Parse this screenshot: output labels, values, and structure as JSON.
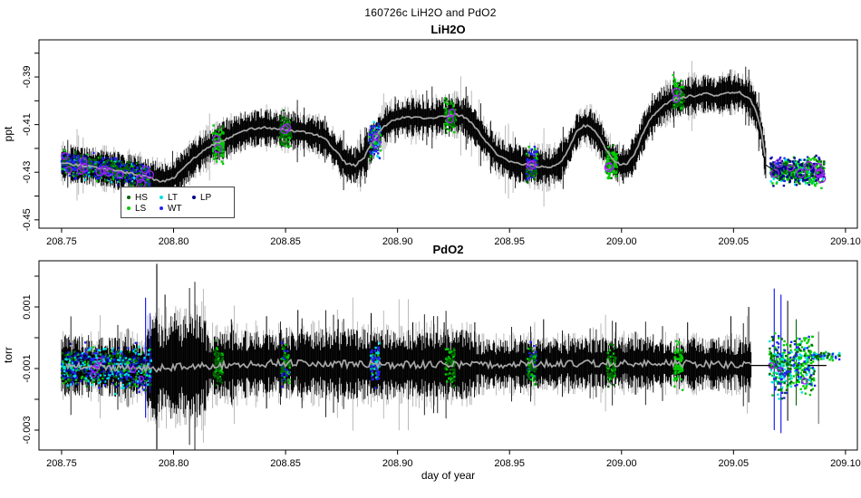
{
  "title": "160726c  LiH2O and PdO2",
  "colors": {
    "HS": "#006400",
    "LS": "#00CD00",
    "LT": "#00E0E0",
    "WT": "#2222EE",
    "LP": "#00008B",
    "circle": "#A020F0",
    "mean_line": "#A6A6A6",
    "noise": "#000000",
    "noise_fringe": "#7E7E7E",
    "axis": "#000000"
  },
  "chart_data": [
    {
      "type": "line",
      "title": "LiH2O",
      "ylabel": "ppt",
      "xlabel": "",
      "xlim": [
        208.7399,
        209.1053
      ],
      "ylim": [
        -0.4535,
        -0.3744
      ],
      "grid": false,
      "legend_position": "bottom-left-inside",
      "legend": {
        "rows": [
          [
            "HS",
            "LT",
            "LP"
          ],
          [
            "LS",
            "WT"
          ]
        ]
      },
      "xticks": {
        "values": [
          208.75,
          208.8,
          208.85,
          208.9,
          208.95,
          209.0,
          209.05,
          209.1
        ],
        "labels": [
          "208.75",
          "208.80",
          "208.85",
          "208.90",
          "208.95",
          "209.00",
          "209.05",
          "209.10"
        ]
      },
      "yticks": {
        "values": [
          -0.39,
          -0.41,
          -0.43,
          -0.45
        ],
        "labels": [
          "-0.39",
          "-0.41",
          "-0.43",
          "-0.45"
        ],
        "minor": [
          -0.38,
          -0.4,
          -0.42,
          -0.44
        ]
      },
      "noise": {
        "x_range": [
          208.75,
          209.0645
        ],
        "base_amp": 0.006,
        "segments": [
          [
            208.7,
            209.11,
            0.006
          ]
        ]
      },
      "mean": {
        "x_range": [
          208.75,
          209.0645
        ],
        "jitter": 0.0005,
        "points": [
          [
            208.75,
            -0.4262
          ],
          [
            208.758,
            -0.427
          ],
          [
            208.766,
            -0.428
          ],
          [
            208.774,
            -0.4292
          ],
          [
            208.782,
            -0.4306
          ],
          [
            208.79,
            -0.4326
          ],
          [
            208.795,
            -0.434
          ],
          [
            208.799,
            -0.433
          ],
          [
            208.804,
            -0.429
          ],
          [
            208.809,
            -0.4242
          ],
          [
            208.814,
            -0.4205
          ],
          [
            208.819,
            -0.4178
          ],
          [
            208.823,
            -0.4162
          ],
          [
            208.828,
            -0.414
          ],
          [
            208.833,
            -0.4122
          ],
          [
            208.839,
            -0.4113
          ],
          [
            208.845,
            -0.4116
          ],
          [
            208.851,
            -0.4123
          ],
          [
            208.857,
            -0.4129
          ],
          [
            208.863,
            -0.414
          ],
          [
            208.868,
            -0.4163
          ],
          [
            208.873,
            -0.4218
          ],
          [
            208.877,
            -0.4262
          ],
          [
            208.881,
            -0.4272
          ],
          [
            208.885,
            -0.4238
          ],
          [
            208.889,
            -0.417
          ],
          [
            208.893,
            -0.4115
          ],
          [
            208.897,
            -0.4085
          ],
          [
            208.902,
            -0.4072
          ],
          [
            208.908,
            -0.4068
          ],
          [
            208.914,
            -0.4072
          ],
          [
            208.92,
            -0.4064
          ],
          [
            208.926,
            -0.4058
          ],
          [
            208.93,
            -0.4068
          ],
          [
            208.934,
            -0.4105
          ],
          [
            208.939,
            -0.4165
          ],
          [
            208.944,
            -0.4222
          ],
          [
            208.949,
            -0.4252
          ],
          [
            208.955,
            -0.4266
          ],
          [
            208.961,
            -0.4274
          ],
          [
            208.967,
            -0.4282
          ],
          [
            208.972,
            -0.4266
          ],
          [
            208.976,
            -0.4212
          ],
          [
            208.98,
            -0.413
          ],
          [
            208.983,
            -0.4105
          ],
          [
            208.986,
            -0.4107
          ],
          [
            208.99,
            -0.415
          ],
          [
            208.994,
            -0.422
          ],
          [
            208.997,
            -0.4258
          ],
          [
            209.0,
            -0.4268
          ],
          [
            209.003,
            -0.4262
          ],
          [
            209.006,
            -0.422
          ],
          [
            209.009,
            -0.415
          ],
          [
            209.012,
            -0.409
          ],
          [
            209.016,
            -0.404
          ],
          [
            209.02,
            -0.401
          ],
          [
            209.024,
            -0.3992
          ],
          [
            209.028,
            -0.3984
          ],
          [
            209.033,
            -0.3978
          ],
          [
            209.038,
            -0.397
          ],
          [
            209.043,
            -0.3978
          ],
          [
            209.048,
            -0.3964
          ],
          [
            209.053,
            -0.3966
          ],
          [
            209.057,
            -0.3988
          ],
          [
            209.06,
            -0.404
          ],
          [
            209.0625,
            -0.4135
          ],
          [
            209.0645,
            -0.427
          ]
        ]
      },
      "spikes": [],
      "clusters": {
        "spread_discrete": 0.0095,
        "width_discrete": 0.005,
        "discrete_circles": 2,
        "dense": [
          {
            "x_range": [
              208.75,
              208.7895
            ],
            "level": "follow",
            "spread": 0.0072,
            "palette": [
              "WT",
              "LP",
              "WT",
              "LP",
              "LS",
              "HS",
              "LT",
              "LS",
              "HS",
              "WT"
            ],
            "n": 780,
            "circles": 13,
            "circle_r": 3.4
          },
          {
            "x_range": [
              209.0665,
              209.0905
            ],
            "level": -0.4295,
            "spread": 0.0075,
            "palette": [
              "LS",
              "HS",
              "WT",
              "LT",
              "LP",
              "LS"
            ],
            "n": 620,
            "circles": 9,
            "circle_r": 3.4
          }
        ],
        "discrete": [
          {
            "day": 208.82,
            "level": -0.418,
            "palette": [
              "LS",
              "HS",
              "LS"
            ],
            "n": 125
          },
          {
            "day": 208.85,
            "level": -0.4128,
            "palette": [
              "LS",
              "HS"
            ],
            "n": 120
          },
          {
            "day": 208.89,
            "level": -0.4165,
            "palette": [
              "LS",
              "LT",
              "WT",
              "HS",
              "WT"
            ],
            "n": 135
          },
          {
            "day": 208.9235,
            "level": -0.4068,
            "palette": [
              "LS",
              "HS",
              "LS"
            ],
            "n": 120
          },
          {
            "day": 208.96,
            "level": -0.4275,
            "palette": [
              "LS",
              "HS",
              "WT",
              "WT"
            ],
            "n": 125
          },
          {
            "day": 208.9955,
            "level": -0.4262,
            "palette": [
              "LS",
              "LS",
              "HS"
            ],
            "n": 115
          },
          {
            "day": 209.0255,
            "level": -0.3982,
            "palette": [
              "LS",
              "HS",
              "LS"
            ],
            "n": 120
          }
        ]
      },
      "extra_lines": [
        {
          "pts": [
            [
              209.0645,
              -0.427
            ],
            [
              209.0685,
              -0.4295
            ]
          ],
          "width": 1
        }
      ]
    },
    {
      "type": "line",
      "title": "PdO2",
      "ylabel": "torr",
      "xlabel": "day of year",
      "xlim": [
        208.7399,
        209.1053
      ],
      "ylim": [
        -0.003647,
        0.0025
      ],
      "grid": false,
      "xticks": {
        "values": [
          208.75,
          208.8,
          208.85,
          208.9,
          208.95,
          209.0,
          209.05,
          209.1
        ],
        "labels": [
          "208.75",
          "208.80",
          "208.85",
          "208.90",
          "208.95",
          "209.00",
          "209.05",
          "209.10"
        ]
      },
      "yticks": {
        "values": [
          0.001,
          -0.001,
          -0.003
        ],
        "labels": [
          "0.001",
          "-0.001",
          "-0.003"
        ],
        "minor": [
          0.002,
          0.0,
          -0.002
        ]
      },
      "noise": {
        "x_range": [
          208.75,
          209.058
        ],
        "base_amp": 0.0007,
        "segments": [
          [
            208.7,
            208.788,
            0.00075
          ],
          [
            208.788,
            208.814,
            0.00125
          ],
          [
            208.814,
            208.935,
            0.00085
          ],
          [
            208.935,
            209.11,
            0.00062
          ]
        ]
      },
      "mean": {
        "x_range": [
          208.752,
          209.058
        ],
        "jitter": 0.00012,
        "points": [
          [
            208.752,
            -0.0009
          ],
          [
            208.79,
            -0.001
          ],
          [
            208.81,
            -0.00092
          ],
          [
            208.85,
            -0.00082
          ],
          [
            208.9,
            -0.00088
          ],
          [
            208.95,
            -0.00086
          ],
          [
            209.0,
            -0.00082
          ],
          [
            209.04,
            -0.00086
          ],
          [
            209.058,
            -0.00088
          ]
        ]
      },
      "spikes": [
        {
          "d": 208.7875,
          "hi": 0.0013,
          "lo": -0.0026,
          "color": "WT",
          "w": 1.2
        },
        {
          "d": 208.7895,
          "hi": 0.0008,
          "lo": -0.0018,
          "color": "WT",
          "w": 1
        },
        {
          "d": 208.7925,
          "hi": 0.0024,
          "lo": -0.00362,
          "color": "noise",
          "w": 1.1
        },
        {
          "d": 208.7962,
          "hi": 0.0014,
          "lo": -0.0016,
          "color": "noise",
          "w": 1
        },
        {
          "d": 208.8005,
          "hi": 0.0008,
          "lo": -0.0023,
          "color": "noise",
          "w": 1
        },
        {
          "d": 208.8118,
          "hi": 0.0007,
          "lo": -0.0025,
          "color": "noise",
          "w": 1
        },
        {
          "d": 208.8258,
          "hi": 0.0006,
          "lo": -0.0021,
          "color": "noise",
          "w": 1
        },
        {
          "d": 208.8415,
          "hi": 0.0007,
          "lo": -0.0023,
          "color": "noise",
          "w": 1
        },
        {
          "d": 208.8555,
          "hi": 0.0009,
          "lo": -0.0019,
          "color": "noise",
          "w": 1
        },
        {
          "d": 208.8735,
          "hi": 0.0006,
          "lo": -0.0021,
          "color": "noise",
          "w": 1
        },
        {
          "d": 208.8882,
          "hi": 0.0008,
          "lo": -0.0017,
          "color": "noise",
          "w": 1
        },
        {
          "d": 208.9068,
          "hi": 0.0005,
          "lo": -0.0019,
          "color": "noise",
          "w": 1
        },
        {
          "d": 208.9208,
          "hi": 0.0005,
          "lo": -0.0015,
          "color": "noise",
          "w": 1
        },
        {
          "d": 208.9345,
          "hi": 0.0005,
          "lo": -0.0017,
          "color": "noise",
          "w": 1
        },
        {
          "d": 208.9652,
          "hi": 0.0006,
          "lo": -0.0015,
          "color": "noise",
          "w": 1
        },
        {
          "d": 208.9975,
          "hi": 0.0005,
          "lo": -0.0015,
          "color": "noise",
          "w": 1
        },
        {
          "d": 209.0295,
          "hi": 0.0005,
          "lo": -0.0014,
          "color": "noise",
          "w": 1
        },
        {
          "d": 209.0488,
          "hi": 0.0007,
          "lo": -0.0016,
          "color": "noise",
          "w": 1
        },
        {
          "d": 209.0568,
          "hi": 0.001,
          "lo": -0.0021,
          "color": "noise",
          "w": 1
        },
        {
          "d": 209.0682,
          "hi": 0.0016,
          "lo": -0.003,
          "color": "WT",
          "w": 1.2
        },
        {
          "d": 209.0712,
          "hi": 0.0014,
          "lo": -0.0031,
          "color": "WT",
          "w": 1.2
        },
        {
          "d": 209.0742,
          "hi": 0.0012,
          "lo": -0.0027,
          "color": "noise",
          "w": 1
        },
        {
          "d": 209.078,
          "hi": 0.0006,
          "lo": -0.0022,
          "color": "HS",
          "w": 1.1
        },
        {
          "d": 209.088,
          "hi": 0.0002,
          "lo": -0.0028,
          "color": "#6E6E6E",
          "w": 1.1
        }
      ],
      "clusters": {
        "spread_discrete": 0.0009,
        "width_discrete": 0.004,
        "discrete_circles": 0,
        "dense": [
          {
            "x_range": [
              208.75,
              208.79
            ],
            "level": "follow",
            "spread": 0.0009,
            "palette": [
              "WT",
              "WT",
              "LP",
              "WT",
              "LS",
              "HS",
              "LT",
              "LT"
            ],
            "n": 720,
            "circles": 6,
            "circle_r": 2.2
          },
          {
            "x_range": [
              209.066,
              209.0865
            ],
            "level": -0.0009,
            "spread": 0.0013,
            "palette": [
              "LS",
              "HS",
              "LS",
              "LT",
              "WT",
              "LS"
            ],
            "n": 470,
            "circles": 3,
            "circle_r": 2.2
          },
          {
            "x_range": [
              209.0855,
              209.0975
            ],
            "level": -0.0006,
            "spread": 0.00018,
            "palette": [
              "LT",
              "LT",
              "LT",
              "WT",
              "LS",
              "HS"
            ],
            "n": 60,
            "circles": 0,
            "circle_r": 2
          }
        ],
        "discrete": [
          {
            "day": 208.82,
            "level": -0.0009,
            "palette": [
              "HS",
              "HS",
              "LS"
            ],
            "n": 85
          },
          {
            "day": 208.85,
            "level": -0.0009,
            "palette": [
              "LS",
              "HS",
              "WT"
            ],
            "n": 85
          },
          {
            "day": 208.89,
            "level": -0.0009,
            "palette": [
              "WT",
              "LT",
              "LS",
              "WT"
            ],
            "n": 90
          },
          {
            "day": 208.9235,
            "level": -0.0009,
            "palette": [
              "LS",
              "HS"
            ],
            "n": 80
          },
          {
            "day": 208.96,
            "level": -0.0009,
            "palette": [
              "LS",
              "WT",
              "HS"
            ],
            "n": 85
          },
          {
            "day": 208.9955,
            "level": -0.0009,
            "palette": [
              "LS",
              "HS"
            ],
            "n": 80
          },
          {
            "day": 209.0255,
            "level": -0.0009,
            "palette": [
              "LS",
              "HS",
              "LS"
            ],
            "n": 85
          }
        ]
      },
      "extra_lines": [
        {
          "pts": [
            [
              209.058,
              -0.0009
            ],
            [
              209.0665,
              -0.0009
            ]
          ],
          "width": 1.2
        },
        {
          "pts": [
            [
              209.0835,
              -0.0009
            ],
            [
              209.0915,
              -0.0009
            ]
          ],
          "width": 1.2
        }
      ]
    }
  ]
}
